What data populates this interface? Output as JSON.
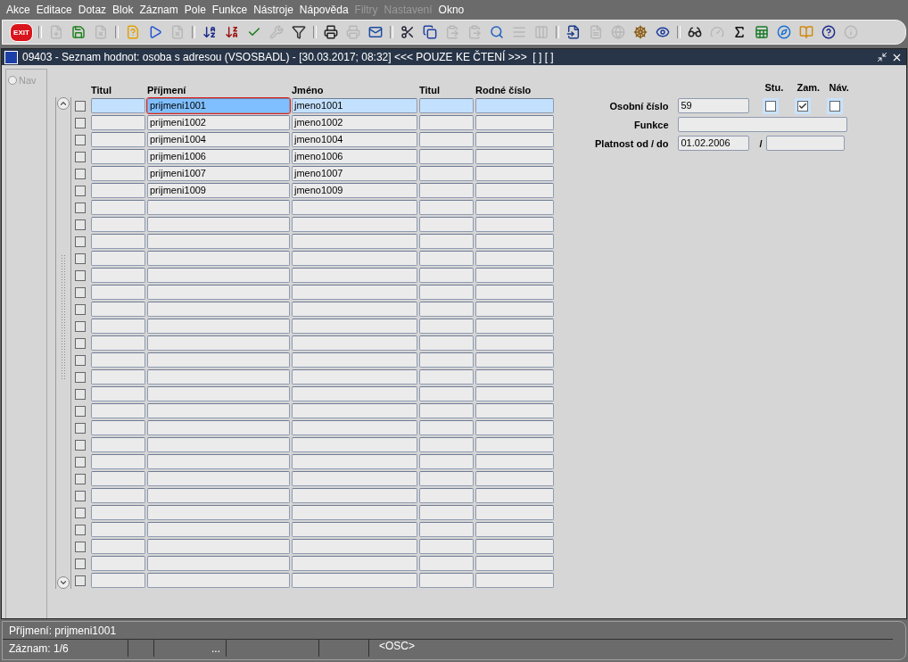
{
  "menu": [
    {
      "label": "Akce",
      "disabled": false
    },
    {
      "label": "Editace",
      "disabled": false
    },
    {
      "label": "Dotaz",
      "disabled": false
    },
    {
      "label": "Blok",
      "disabled": false
    },
    {
      "label": "Záznam",
      "disabled": false
    },
    {
      "label": "Pole",
      "disabled": false
    },
    {
      "label": "Funkce",
      "disabled": false
    },
    {
      "label": "Nástroje",
      "disabled": false
    },
    {
      "label": "Nápověda",
      "disabled": false
    },
    {
      "label": "Filtry",
      "disabled": true
    },
    {
      "label": "Nastavení",
      "disabled": true
    },
    {
      "label": "Okno",
      "disabled": false
    }
  ],
  "toolbar": [
    [
      {
        "kind": "exit",
        "label": "EXIT"
      }
    ],
    [
      {
        "kind": "insert",
        "disabled": true
      },
      {
        "kind": "save",
        "disabled": false
      },
      {
        "kind": "delete",
        "disabled": true
      }
    ],
    [
      {
        "kind": "query",
        "disabled": false
      },
      {
        "kind": "execute",
        "disabled": false
      },
      {
        "kind": "cancel",
        "disabled": true
      }
    ],
    [
      {
        "kind": "sort-asc",
        "disabled": false
      },
      {
        "kind": "sort-desc",
        "disabled": false
      },
      {
        "kind": "check",
        "disabled": false
      },
      {
        "kind": "wrench",
        "disabled": true
      },
      {
        "kind": "filter",
        "disabled": false
      }
    ],
    [
      {
        "kind": "print",
        "disabled": false
      },
      {
        "kind": "printer",
        "disabled": true
      },
      {
        "kind": "mail",
        "disabled": false
      }
    ],
    [
      {
        "kind": "cut",
        "disabled": false
      },
      {
        "kind": "copy",
        "disabled": false
      },
      {
        "kind": "paste",
        "disabled": true
      },
      {
        "kind": "paste",
        "disabled": true
      },
      {
        "kind": "zoom",
        "disabled": false
      },
      {
        "kind": "rows",
        "disabled": true
      },
      {
        "kind": "columns",
        "disabled": true
      }
    ],
    [
      {
        "kind": "import",
        "disabled": false
      },
      {
        "kind": "document",
        "disabled": true
      },
      {
        "kind": "globe",
        "disabled": true
      },
      {
        "kind": "wheel",
        "disabled": false
      },
      {
        "kind": "eye",
        "disabled": false
      }
    ],
    [
      {
        "kind": "glasses",
        "disabled": false
      },
      {
        "kind": "gauge",
        "disabled": true
      },
      {
        "kind": "sigma",
        "disabled": false
      },
      {
        "kind": "sheet",
        "disabled": false
      },
      {
        "kind": "browser",
        "disabled": false
      },
      {
        "kind": "help-books",
        "disabled": false
      },
      {
        "kind": "help",
        "disabled": false
      },
      {
        "kind": "info",
        "disabled": true
      }
    ]
  ],
  "window": {
    "title": "09403 - Seznam hodnot: osoba s adresou (VSOSBADL) - [30.03.2017; 08:32] <<< POUZE KE ČTENÍ >>>  [ ] [ ]"
  },
  "nav": {
    "label": "Nav",
    "selected": false
  },
  "table": {
    "columns": [
      "Titul",
      "Příjmení",
      "Jméno",
      "Titul",
      "Rodné číslo"
    ],
    "rows": [
      {
        "selected": true,
        "checked": false,
        "cells": [
          "",
          "prijmeni1001",
          "jmeno1001",
          "",
          ""
        ]
      },
      {
        "selected": false,
        "checked": false,
        "cells": [
          "",
          "prijmeni1002",
          "jmeno1002",
          "",
          ""
        ]
      },
      {
        "selected": false,
        "checked": false,
        "cells": [
          "",
          "prijmeni1004",
          "jmeno1004",
          "",
          ""
        ]
      },
      {
        "selected": false,
        "checked": false,
        "cells": [
          "",
          "prijmeni1006",
          "jmeno1006",
          "",
          ""
        ]
      },
      {
        "selected": false,
        "checked": false,
        "cells": [
          "",
          "prijmeni1007",
          "jmeno1007",
          "",
          ""
        ]
      },
      {
        "selected": false,
        "checked": false,
        "cells": [
          "",
          "prijmeni1009",
          "jmeno1009",
          "",
          ""
        ]
      },
      {
        "selected": false,
        "checked": false
      },
      {
        "selected": false,
        "checked": false
      },
      {
        "selected": false,
        "checked": false
      },
      {
        "selected": false,
        "checked": false
      },
      {
        "selected": false,
        "checked": false
      },
      {
        "selected": false,
        "checked": false
      },
      {
        "selected": false,
        "checked": false
      },
      {
        "selected": false,
        "checked": false
      },
      {
        "selected": false,
        "checked": false
      },
      {
        "selected": false,
        "checked": false
      },
      {
        "selected": false,
        "checked": false
      },
      {
        "selected": false,
        "checked": false
      },
      {
        "selected": false,
        "checked": false
      },
      {
        "selected": false,
        "checked": false
      },
      {
        "selected": false,
        "checked": false
      },
      {
        "selected": false,
        "checked": false
      },
      {
        "selected": false,
        "checked": false
      },
      {
        "selected": false,
        "checked": false
      },
      {
        "selected": false,
        "checked": false
      },
      {
        "selected": false,
        "checked": false
      },
      {
        "selected": false,
        "checked": false
      },
      {
        "selected": false,
        "checked": false
      },
      {
        "selected": false,
        "checked": false
      }
    ]
  },
  "detail": {
    "osobni_cislo": {
      "label": "Osobní číslo",
      "value": "59"
    },
    "flags": [
      {
        "label": "Stu.",
        "checked": false
      },
      {
        "label": "Zam.",
        "checked": true
      },
      {
        "label": "Náv.",
        "checked": false
      }
    ],
    "funkce": {
      "label": "Funkce"
    },
    "platnost": {
      "label": "Platnost od / do",
      "from": "01.02.2006",
      "separator": "/"
    }
  },
  "status": {
    "message": "Příjmení: prijmeni1001",
    "record": "Záznam: 1/6",
    "ellipsis": "...",
    "mode": "<OSC>"
  }
}
